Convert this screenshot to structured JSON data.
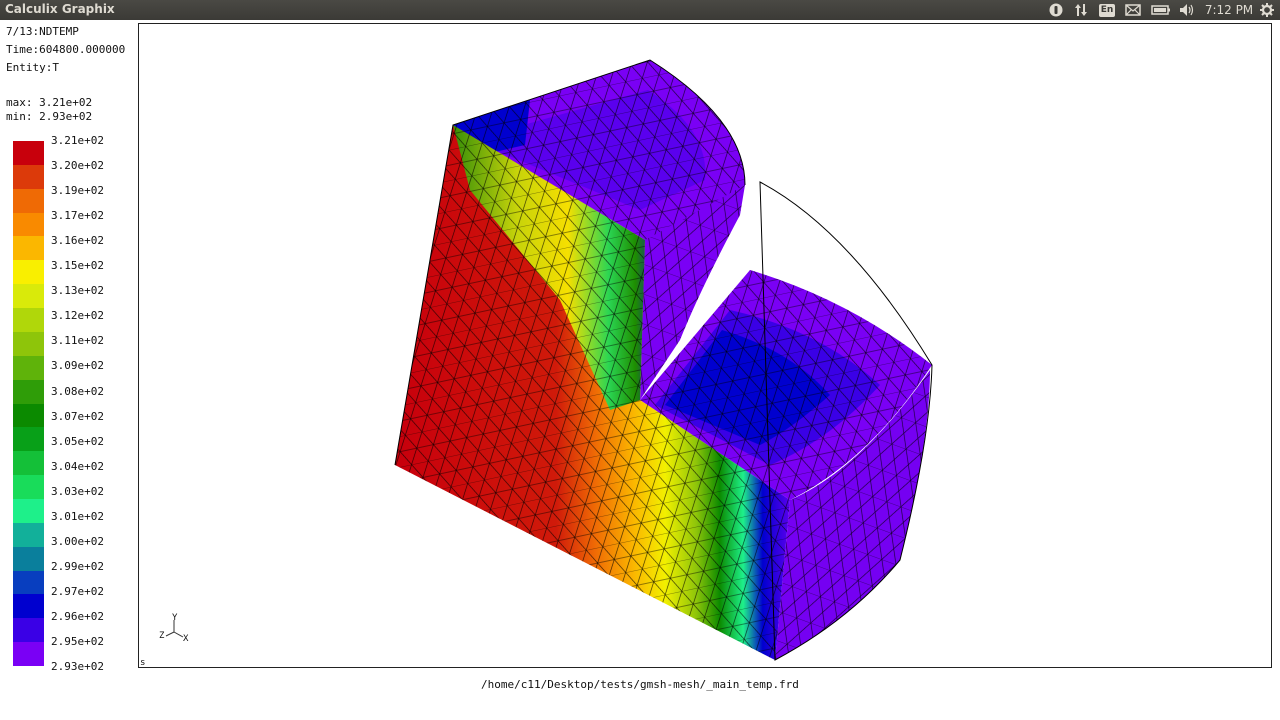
{
  "topbar": {
    "app_title": "Calculix Graphix",
    "lang": "En",
    "time": "7:12 PM",
    "icons": [
      "info-icon",
      "network-updown-icon",
      "keyboard-lang-icon",
      "mail-icon",
      "battery-icon",
      "volume-icon",
      "settings-gear-icon"
    ]
  },
  "info": {
    "step": "7/13:NDTEMP",
    "time": "Time:604800.000000",
    "entity": "Entity:T",
    "max": "max: 3.21e+02",
    "min": "min: 2.93e+02"
  },
  "legend": {
    "labels": [
      "3.21e+02",
      "3.20e+02",
      "3.19e+02",
      "3.17e+02",
      "3.16e+02",
      "3.15e+02",
      "3.13e+02",
      "3.12e+02",
      "3.11e+02",
      "3.09e+02",
      "3.08e+02",
      "3.07e+02",
      "3.05e+02",
      "3.04e+02",
      "3.03e+02",
      "3.01e+02",
      "3.00e+02",
      "2.99e+02",
      "2.97e+02",
      "2.96e+02",
      "2.95e+02",
      "2.93e+02"
    ],
    "colors": [
      "#c8000c",
      "#dc3a0a",
      "#ef6a05",
      "#f98a00",
      "#fbb700",
      "#f9ef00",
      "#d9ea0a",
      "#b0d70a",
      "#8ec50a",
      "#5fb30a",
      "#2f9d08",
      "#0b8a00",
      "#08a018",
      "#14c038",
      "#19dc5a",
      "#1ef08a",
      "#12b09a",
      "#0a7f9c",
      "#083ebf",
      "#0000cf",
      "#3a00e6",
      "#7a00f5"
    ]
  },
  "axes": {
    "y": "Y",
    "z": "Z",
    "x": "X"
  },
  "corner_mark": "s",
  "file_path": "/home/c11/Desktop/tests/gmsh-mesh/_main_temp.frd"
}
